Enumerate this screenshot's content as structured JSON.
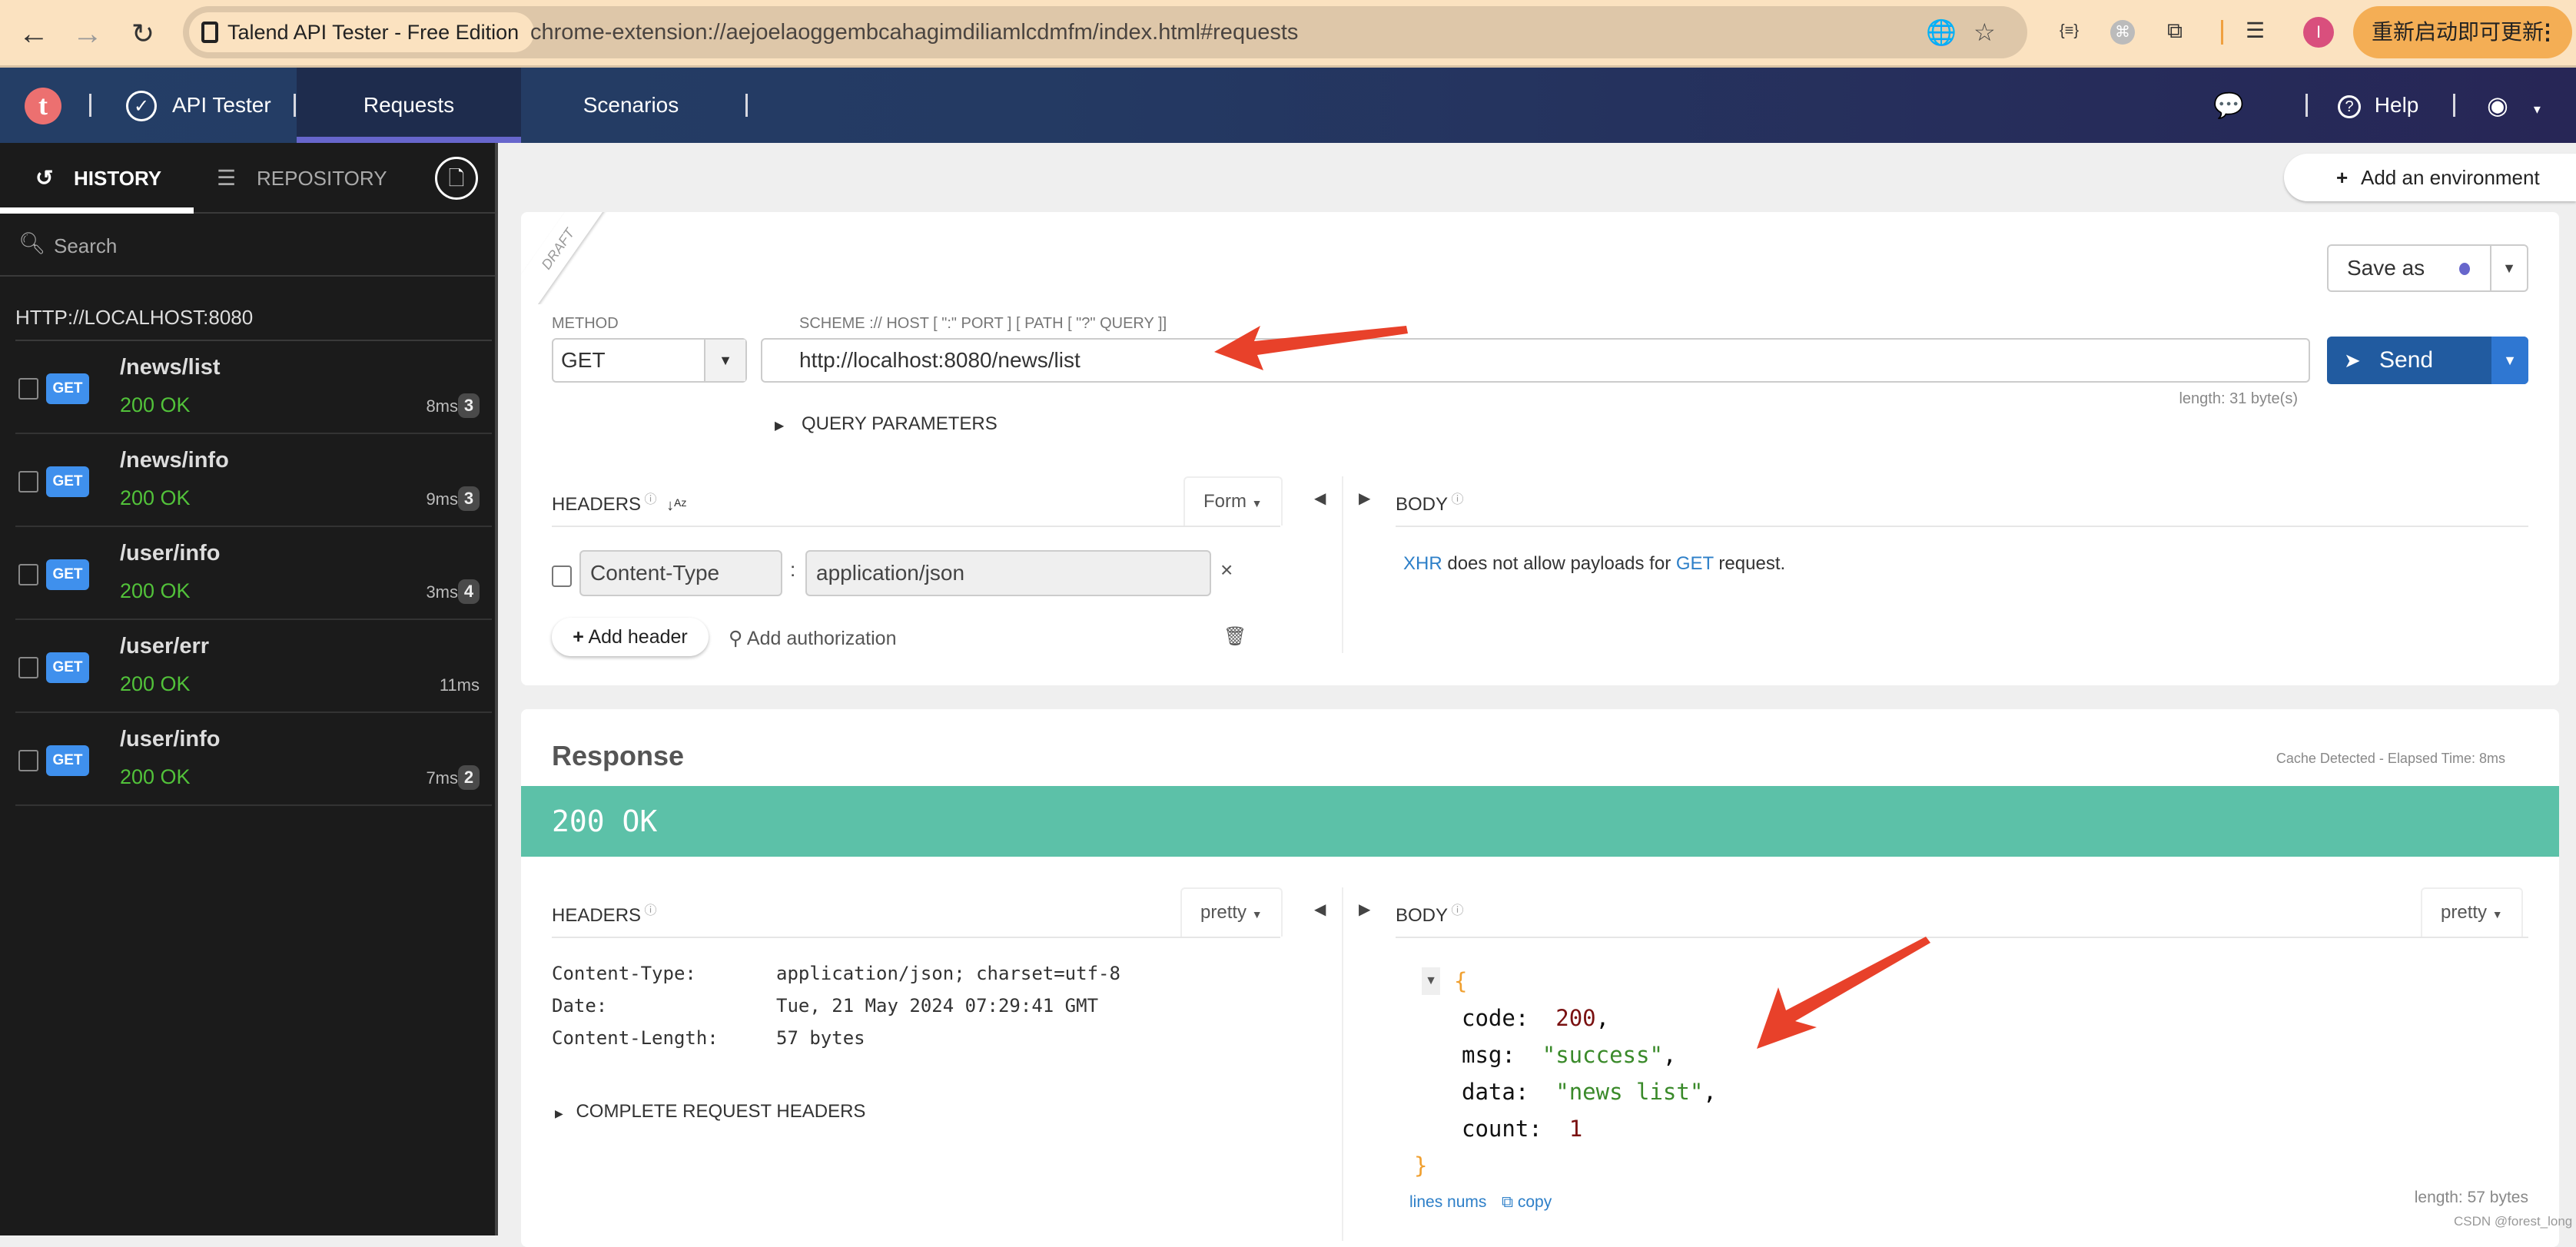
{
  "browser": {
    "tab_chip": "Talend API Tester - Free Edition",
    "url": "chrome-extension://aejoelaoggembcahagimdiliamlcdmfm/index.html#requests",
    "profile_initial": "I",
    "update_button": "重新启动即可更新",
    "icons": [
      "back-icon",
      "forward-icon",
      "reload-icon",
      "translate-icon",
      "star-icon",
      "json-ext-icon",
      "cmd-ext-icon",
      "puzzle-ext-icon",
      "reading-list-icon",
      "more-icon"
    ]
  },
  "app": {
    "logo_letter": "t",
    "title": "API Tester",
    "tabs": [
      {
        "label": "Requests",
        "active": true
      },
      {
        "label": "Scenarios",
        "active": false
      }
    ],
    "help": "Help",
    "accent_color": "#6766cc"
  },
  "sidebar": {
    "tabs": [
      {
        "label": "HISTORY",
        "active": true
      },
      {
        "label": "REPOSITORY",
        "active": false
      }
    ],
    "search_placeholder": "Search",
    "host_group": "HTTP://LOCALHOST:8080",
    "items": [
      {
        "method": "GET",
        "path": "/news/list",
        "status": "200 OK",
        "time": "8ms",
        "count": "3"
      },
      {
        "method": "GET",
        "path": "/news/info",
        "status": "200 OK",
        "time": "9ms",
        "count": "3"
      },
      {
        "method": "GET",
        "path": "/user/info",
        "status": "200 OK",
        "time": "3ms",
        "count": "4"
      },
      {
        "method": "GET",
        "path": "/user/err",
        "status": "200 OK",
        "time": "11ms",
        "count": null
      },
      {
        "method": "GET",
        "path": "/user/info",
        "status": "200 OK",
        "time": "7ms",
        "count": "2"
      }
    ]
  },
  "request": {
    "add_environment": "Add an environment",
    "draft_label": "DRAFT",
    "method_label": "METHOD",
    "method_value": "GET",
    "url_label": "SCHEME :// HOST [ \":\" PORT ] [ PATH [ \"?\" QUERY ]]",
    "url_value": "http://localhost:8080/news/list",
    "save_as": "Save as",
    "send": "Send",
    "length": "length: 31 byte(s)",
    "query_params": "QUERY PARAMETERS",
    "headers_title": "HEADERS",
    "headers_mode": "Form",
    "headers": [
      {
        "key": "Content-Type",
        "value": "application/json",
        "enabled": false
      }
    ],
    "add_header": "Add header",
    "add_authorization": "Add authorization",
    "body_title": "BODY",
    "body_msg": {
      "xhr": "XHR",
      "mid": " does not allow payloads for ",
      "get": "GET",
      "end": " request."
    }
  },
  "response": {
    "title": "Response",
    "elapsed": "Cache Detected - Elapsed Time: 8ms",
    "status": "200 OK",
    "status_color": "#5cc1a8",
    "headers_title": "HEADERS",
    "headers_mode": "pretty",
    "headers": [
      {
        "key": "Content-Type:",
        "value": "application/json; charset=utf-8"
      },
      {
        "key": "Date:",
        "value": "Tue, 21 May 2024 07:29:41 GMT"
      },
      {
        "key": "Content-Length:",
        "value": "57 bytes"
      }
    ],
    "complete_request_headers": "COMPLETE REQUEST HEADERS",
    "body_title": "BODY",
    "body_mode": "pretty",
    "body": {
      "open_brace": "{",
      "close_brace": "}",
      "fields": [
        {
          "key": "code:",
          "value": "200",
          "type": "num",
          "comma": ","
        },
        {
          "key": "msg:",
          "value": "\"success\"",
          "type": "str",
          "comma": ","
        },
        {
          "key": "data:",
          "value": "\"news list\"",
          "type": "str",
          "comma": ","
        },
        {
          "key": "count:",
          "value": "1",
          "type": "num",
          "comma": ""
        }
      ]
    },
    "lines_nums": "lines nums",
    "copy": "copy",
    "length": "length: 57 bytes"
  },
  "watermark": "CSDN @forest_long"
}
